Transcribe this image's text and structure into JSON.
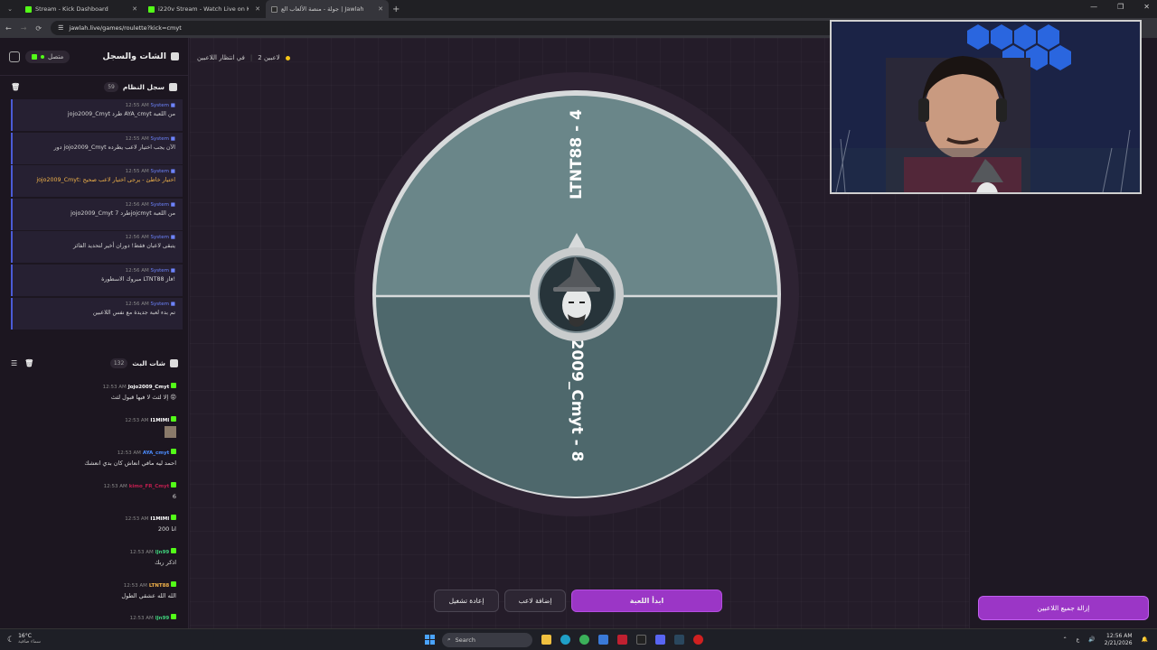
{
  "browser": {
    "tabs": [
      {
        "title": "Stream - Kick Dashboard",
        "active": false
      },
      {
        "title": "i220v Stream - Watch Live on K",
        "active": false
      },
      {
        "title": "جولة - منصة الألعاب الع | Jawlah",
        "active": true
      }
    ],
    "url": "jawlah.live/games/roulette?kick=cmyt"
  },
  "left": {
    "title": "الشات والسجل",
    "connection": "متصل",
    "system_log": {
      "title": "سجل النظام",
      "count": "59",
      "messages": [
        {
          "sender": "System",
          "time": "12:55 AM",
          "text": "jojo2009_Cmyt طرد AYA_cmyt من اللعبة",
          "warn": false
        },
        {
          "sender": "System",
          "time": "12:55 AM",
          "text": "دور jojo2009_Cmyt الآن يجب اختيار لاعب يطرده",
          "warn": false
        },
        {
          "sender": "System",
          "time": "12:55 AM",
          "text": "jojo2009_Cmyt: اختيار خاطئ - يرجى اختيار لاعب صحيح",
          "warn": true
        },
        {
          "sender": "System",
          "time": "12:56 AM",
          "text": "jojo2009_Cmyt طرد 7jojcmyt من اللعبة",
          "warn": false
        },
        {
          "sender": "System",
          "time": "12:56 AM",
          "text": "يتبقى لاعبان فقط! دوران أخير لتحديد الفائز",
          "warn": false
        },
        {
          "sender": "System",
          "time": "12:56 AM",
          "text": "مبروك الاسطورة LTNT88 فاز!",
          "warn": false
        },
        {
          "sender": "System",
          "time": "12:56 AM",
          "text": "تم بدء لعبة جديدة مع نفس اللاعبين",
          "warn": false
        }
      ]
    },
    "live_chat": {
      "title": "شات البث",
      "count": "132",
      "messages": [
        {
          "user": "Jojo2009_Cmyt",
          "time": "12:53 AM",
          "text": "إلا لثث لا فيها قبول لثث 😡",
          "color": "#ffffff"
        },
        {
          "user": "I1MIMI",
          "time": "12:53 AM",
          "text": "",
          "color": "#ffffff"
        },
        {
          "user": "AYA_cmyt",
          "time": "12:53 AM",
          "text": "احمد ليه مافي انعاش كان بدي انعشك",
          "color": "#4c8dff"
        },
        {
          "user": "kimo_FR_Cmyt",
          "time": "12:53 AM",
          "text": "6",
          "color": "#c01f4f"
        },
        {
          "user": "I1MIMI",
          "time": "12:53 AM",
          "text": "انا 200",
          "color": "#ffffff"
        },
        {
          "user": "lJn99",
          "time": "12:53 AM",
          "text": "اذكر ربك",
          "color": "#3ecf7a"
        },
        {
          "user": "LTNT88",
          "time": "12:53 AM",
          "text": "الله الله عشقي الطول",
          "color": "#f3b44a"
        },
        {
          "user": "lJn99",
          "time": "12:53 AM",
          "text": "",
          "color": "#3ecf7a"
        }
      ]
    }
  },
  "main": {
    "player_count": "2 لاعبين",
    "status": "في انتظار اللاعبين",
    "wheel": {
      "segments": [
        {
          "label": "LTNT88 - 4",
          "color": "#6a8689"
        },
        {
          "label": "jojo2009_Cmyt - 8",
          "color": "#4e686c"
        }
      ]
    },
    "buttons": {
      "start": "ابدأ اللعبة",
      "add_player": "إضافة لاعب",
      "replay": "إعادة تشغيل"
    }
  },
  "right": {
    "clear_all": "إزالة جميع اللاعبين"
  },
  "taskbar": {
    "weather_temp": "16°C",
    "weather_desc": "سماء صافية",
    "search": "Search",
    "lang": "ع",
    "time": "12:56 AM",
    "date": "2/21/2026"
  }
}
